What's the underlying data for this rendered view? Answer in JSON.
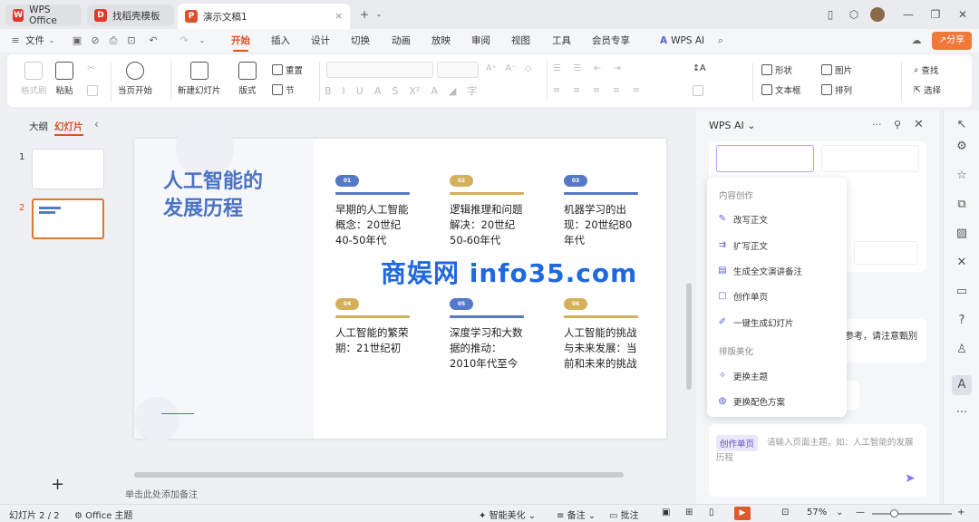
{
  "tabs": [
    {
      "label": "WPS Office",
      "icon": "W"
    },
    {
      "label": "找稻壳模板",
      "icon": "D"
    },
    {
      "label": "演示文稿1",
      "icon": "P"
    }
  ],
  "menu": {
    "file": "文件",
    "items": [
      "开始",
      "插入",
      "设计",
      "切换",
      "动画",
      "放映",
      "审阅",
      "视图",
      "工具",
      "会员专享"
    ],
    "ai": "WPS AI",
    "share": "分享"
  },
  "ribbon": {
    "format_painter": "格式刷",
    "paste": "粘贴",
    "play_from_current": "当页开始",
    "new_slide": "新建幻灯片",
    "layout": "版式",
    "section": "节",
    "reset": "重置",
    "shape": "形状",
    "picture": "图片",
    "find": "查找",
    "textbox": "文本框",
    "arrange": "排列",
    "select": "选择"
  },
  "leftpanel": {
    "outline": "大纲",
    "slides": "幻灯片",
    "slide_numbers": [
      "1",
      "2"
    ]
  },
  "slide": {
    "title_line1": "人工智能的",
    "title_line2": "发展历程",
    "cards": [
      {
        "num": "01",
        "text": "早期的人工智能概念：20世纪40-50年代",
        "color": "#5678c8"
      },
      {
        "num": "02",
        "text": "逻辑推理和问题解决：20世纪50-60年代",
        "color": "#d4b05a"
      },
      {
        "num": "03",
        "text": "机器学习的出现：20世纪80年代",
        "color": "#5678c8"
      },
      {
        "num": "04",
        "text": "人工智能的繁荣期：21世纪初",
        "color": "#d4b05a"
      },
      {
        "num": "05",
        "text": "深度学习和大数据的推动：2010年代至今",
        "color": "#5678c8"
      },
      {
        "num": "06",
        "text": "人工智能的挑战与未来发展：当前和未来的挑战",
        "color": "#d4b05a"
      }
    ]
  },
  "notes_placeholder": "单击此处添加备注",
  "aipanel": {
    "title": "WPS AI",
    "hint": "参考，请注意甄别",
    "popup": {
      "section1": "内容创作",
      "items1": [
        "改写正文",
        "扩写正文",
        "生成全文演讲备注",
        "创作单页",
        "一键生成幻灯片"
      ],
      "section2": "排版美化",
      "items2": [
        "更换主题",
        "更换配色方案"
      ]
    },
    "input_tag": "创作单页",
    "input_placeholder": "请输入页面主题，如：人工智能的发展历程"
  },
  "status": {
    "slide_count": "幻灯片 2 / 2",
    "theme": "Office 主题",
    "beautify": "智能美化",
    "notes": "备注",
    "comments": "批注",
    "zoom": "57%"
  },
  "watermark": "商娱网 info35.com"
}
